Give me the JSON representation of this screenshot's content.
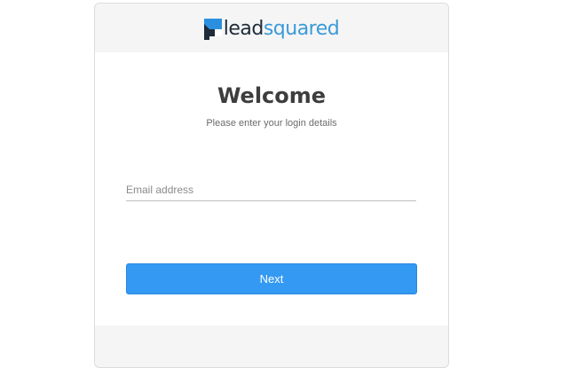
{
  "header": {
    "logo": {
      "icon": "leadsquared-logo-icon",
      "text_part1": "lead",
      "text_part2": "squared",
      "color_dark": "#1e2b3a",
      "color_accent": "#3a9ad9"
    }
  },
  "main": {
    "title": "Welcome",
    "subtitle": "Please enter your login details",
    "email_field": {
      "placeholder": "Email address",
      "value": ""
    },
    "next_label": "Next",
    "accent_color": "#3399f3"
  }
}
